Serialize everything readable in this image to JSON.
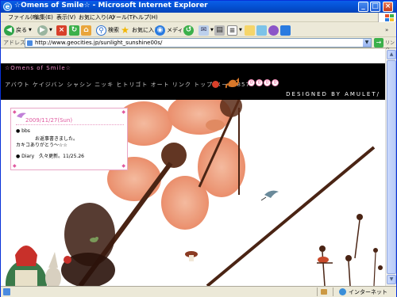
{
  "window": {
    "title": "☆Omens of Smile☆ - Microsoft Internet Explorer",
    "min_label": "_",
    "max_label": "□",
    "close_label": "×"
  },
  "menu": {
    "items": [
      "ファイル(F)",
      "編集(E)",
      "表示(V)",
      "お気に入り(A)",
      "ツール(T)",
      "ヘルプ(H)"
    ]
  },
  "toolbar": {
    "back_label": "戻る",
    "search_label": "検索",
    "favorites_label": "お気に入り",
    "media_label": "メディア"
  },
  "address": {
    "label": "アドレス(D)",
    "url": "http://www.geocities.jp/sunlight_sunshine00s/",
    "links_label": "リンク"
  },
  "site": {
    "title": "☆Omens of Smile☆",
    "nav": "アバウト ケイジバン シャシン ニッキ ヒトリゴト オート リンク トップ メール 8574",
    "counter": [
      "0",
      "0",
      "0",
      "0"
    ],
    "designed_by": "DESIGNED BY AMULET/",
    "blog": {
      "date": "2009/11/27(Sun)",
      "bbs_label": "● bbs",
      "bbs_line1": "　　　　お返事書きました。",
      "bbs_line2": "カキコありがとう～☆☆",
      "diary": "● Diary　久々更新。11/25.26"
    }
  },
  "status": {
    "zone": "インターネット"
  }
}
